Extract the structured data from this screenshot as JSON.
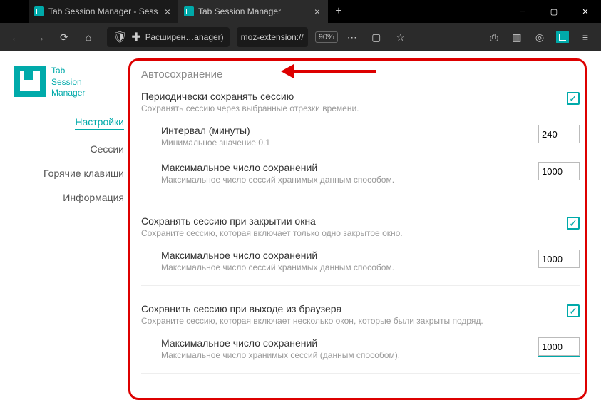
{
  "browser": {
    "tabs": [
      {
        "label": "Tab Session Manager - Sess",
        "active": false
      },
      {
        "label": "Tab Session Manager",
        "active": true
      }
    ],
    "url_label": "Расширен…anager)",
    "url_scheme": "moz-extension://",
    "zoom": "90%"
  },
  "app": {
    "name_line1": "Tab",
    "name_line2": "Session",
    "name_line3": "Manager",
    "nav": {
      "settings": "Настройки",
      "sessions": "Сессии",
      "hotkeys": "Горячие клавиши",
      "info": "Информация"
    }
  },
  "section": {
    "title": "Автосохранение",
    "periodic": {
      "title": "Периодически сохранять сессию",
      "desc": "Сохранять сессию через выбранные отрезки времени.",
      "interval_label": "Интервал (минуты)",
      "interval_desc": "Минимальное значение 0.1",
      "interval_value": "240",
      "max_label": "Максимальное число сохранений",
      "max_desc": "Максимальное число сессий хранимых данным способом.",
      "max_value": "1000"
    },
    "onclose": {
      "title": "Сохранять сессию при закрытии окна",
      "desc": "Сохраните сессию, которая включает только одно закрытое окно.",
      "max_label": "Максимальное число сохранений",
      "max_desc": "Максимальное число сессий хранимых данным способом.",
      "max_value": "1000"
    },
    "onexit": {
      "title": "Сохранить сессию при выходе из браузера",
      "desc": "Сохраните сессию, которая включает несколько окон, которые были закрыты подряд.",
      "max_label": "Максимальное число сохранений",
      "max_desc": "Максимальное число хранимых сессий (данным способом).",
      "max_value": "1000"
    }
  }
}
